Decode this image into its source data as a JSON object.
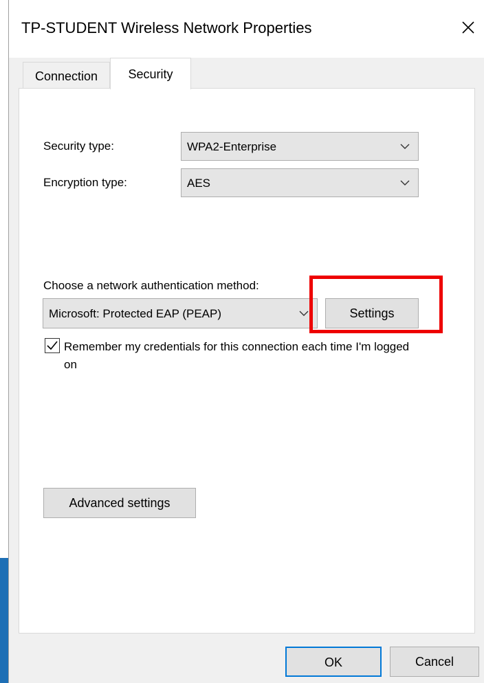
{
  "window": {
    "title": "TP-STUDENT Wireless Network Properties",
    "close_symbol": "✕"
  },
  "tabs": [
    {
      "label": "Connection",
      "active": false
    },
    {
      "label": "Security",
      "active": true
    }
  ],
  "security": {
    "security_type_label": "Security type:",
    "security_type_value": "WPA2-Enterprise",
    "encryption_type_label": "Encryption type:",
    "encryption_type_value": "AES",
    "auth_method_label": "Choose a network authentication method:",
    "auth_method_value": "Microsoft: Protected EAP (PEAP)",
    "settings_button": "Settings",
    "remember_credentials": {
      "checked": true,
      "label": "Remember my credentials for this connection each time I'm logged on"
    },
    "advanced_settings_button": "Advanced settings"
  },
  "footer": {
    "ok_button": "OK",
    "cancel_button": "Cancel"
  },
  "colors": {
    "highlight": "#ee0000",
    "button_face": "#e1e1e1",
    "select_face": "#e5e5e5",
    "taskbar_blue": "#1e6fb5"
  },
  "icons": {
    "close": "close-icon",
    "dropdown": "chevron-down-icon",
    "check": "checkmark-icon"
  }
}
